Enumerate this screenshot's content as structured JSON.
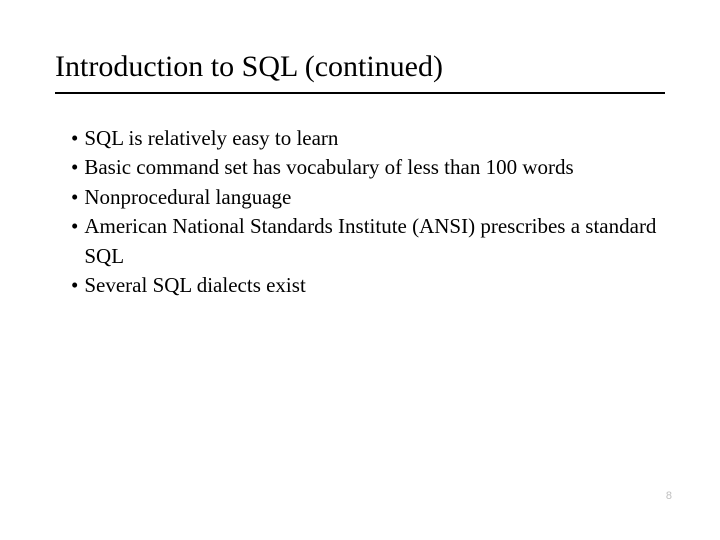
{
  "title": "Introduction to SQL (continued)",
  "bullets": [
    "SQL is relatively easy to learn",
    "Basic command set has vocabulary of less than 100 words",
    "Nonprocedural language",
    "American National Standards Institute (ANSI) prescribes a standard SQL",
    "Several SQL dialects exist"
  ],
  "page_number": "8",
  "bullet_glyph": "•"
}
